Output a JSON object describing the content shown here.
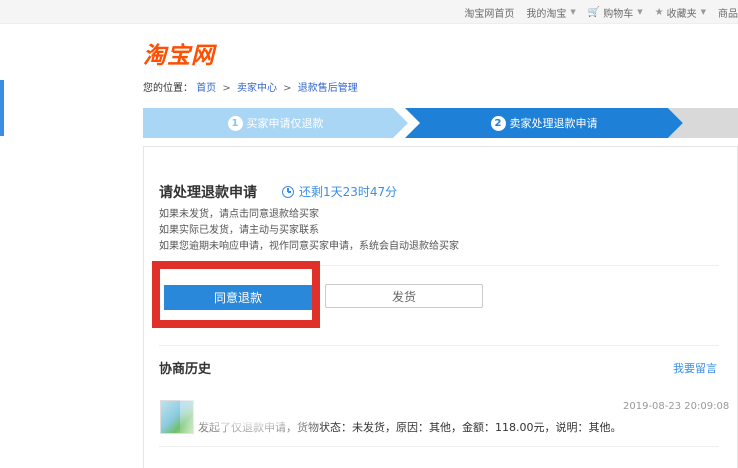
{
  "topnav": {
    "home": "淘宝网首页",
    "my_taobao": "我的淘宝",
    "cart": "购物车",
    "favorites": "收藏夹",
    "more": "商品"
  },
  "logo": "淘宝网",
  "breadcrumb": {
    "prefix": "您的位置：",
    "items": [
      "首页",
      "卖家中心",
      "退款售后管理"
    ],
    "separator": ">"
  },
  "steps": [
    {
      "num": "1",
      "label": "买家申请仅退款"
    },
    {
      "num": "2",
      "label": "卖家处理退款申请"
    }
  ],
  "request": {
    "title": "请处理退款申请",
    "countdown": "还剩1天23时47分",
    "notes": [
      "如果未发货，请点击同意退款给买家",
      "如果实际已发货，请主动与买家联系",
      "如果您逾期未响应申请，视作同意买家申请，系统会自动退款给买家"
    ],
    "agree_button": "同意退款",
    "ship_button": "发货"
  },
  "history": {
    "title": "协商历史",
    "leave_message": "我要留言",
    "entries": [
      {
        "timestamp": "2019-08-23 20:09:08",
        "text": "发起了仅退款申请，货物状态：未发货，原因：其他，金额：118.00元，说明：其他。"
      }
    ]
  },
  "colors": {
    "brand": "#ff4f00",
    "accent": "#2a88da",
    "highlight": "#e0302a"
  }
}
